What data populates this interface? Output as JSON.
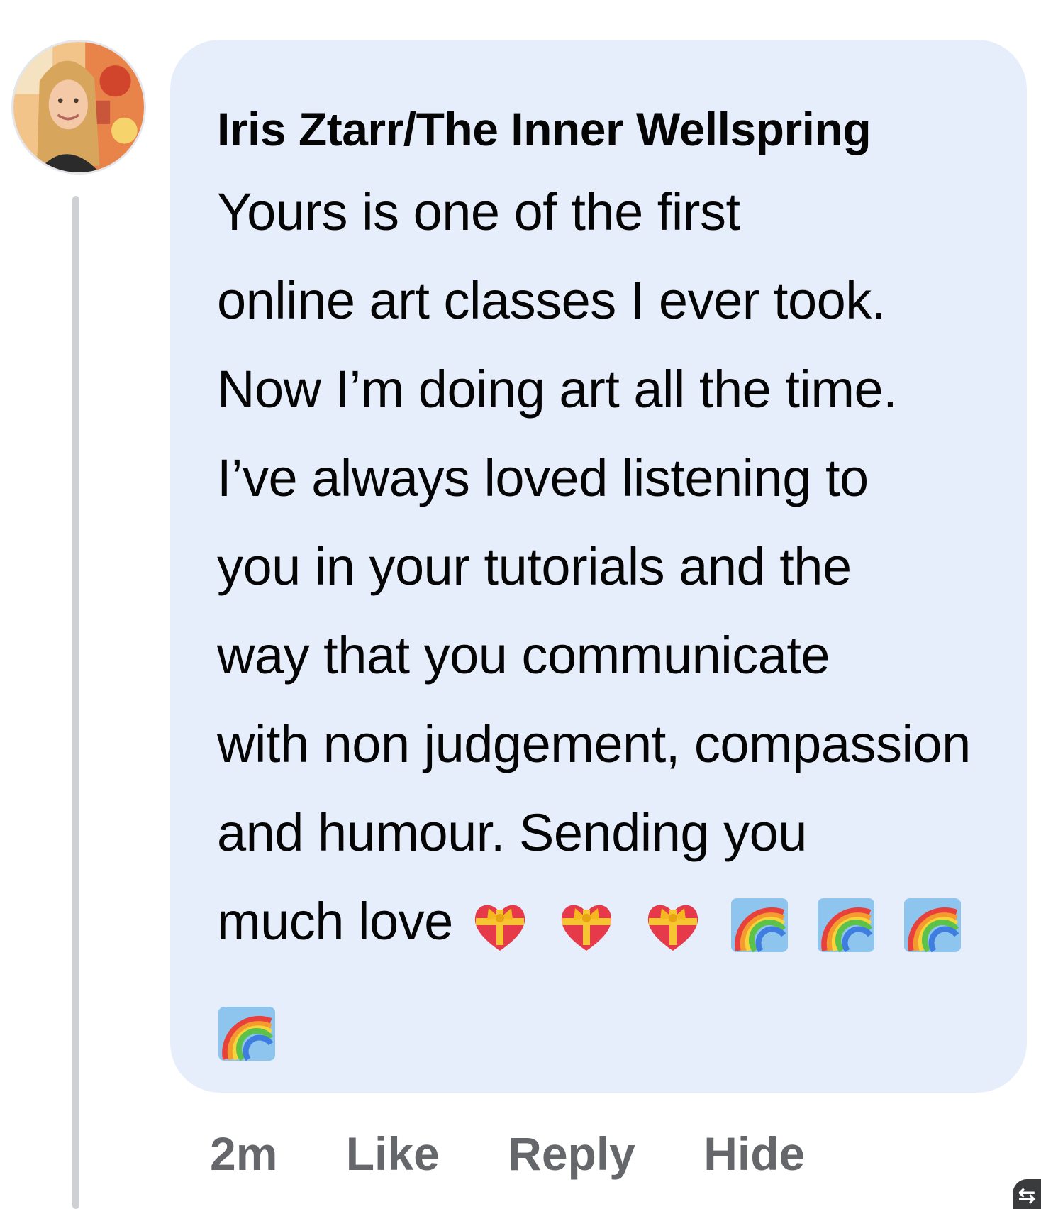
{
  "comment": {
    "author": "Iris Ztarr/The Inner Wellspring",
    "lines": [
      "Yours is one of the first",
      "online art classes I ever took.",
      "Now I’m doing art all the time.",
      "I’ve always loved listening to",
      "you in your tutorials and the",
      "way that you communicate",
      "with non judgement, compassion",
      "and humour. Sending you",
      "much love"
    ],
    "emojis": [
      "heart-with-ribbon-icon",
      "heart-with-ribbon-icon",
      "heart-with-ribbon-icon",
      "rainbow-icon",
      "rainbow-icon",
      "rainbow-icon",
      "rainbow-icon"
    ]
  },
  "actions": {
    "time": "2m",
    "like": "Like",
    "reply": "Reply",
    "hide": "Hide"
  },
  "colors": {
    "bubble": "#e7eefb",
    "text": "#050505",
    "meta": "#65676b",
    "thread_line": "#ced0d4"
  }
}
